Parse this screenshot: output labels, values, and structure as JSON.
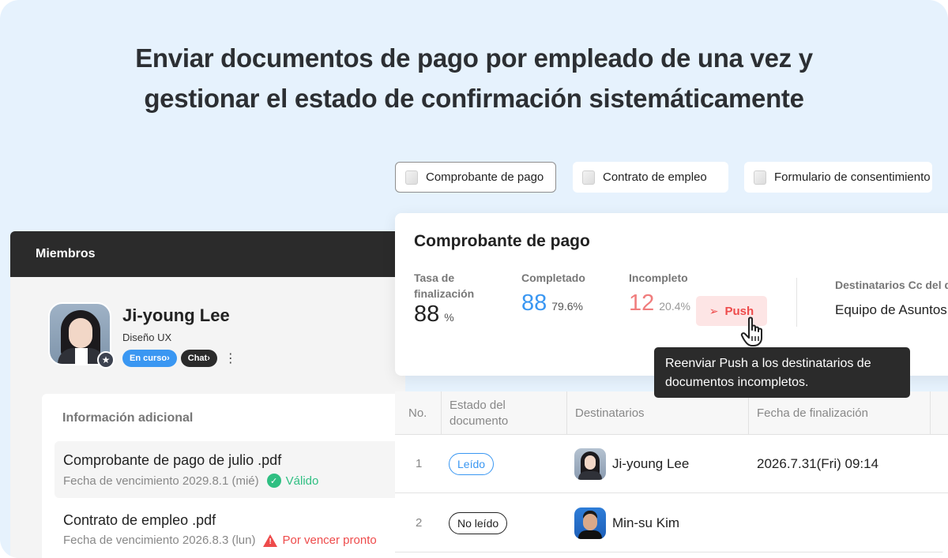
{
  "headline": {
    "line1": "Enviar documentos de pago por empleado de una vez y",
    "line2": "gestionar el estado de confirmación sistemáticamente"
  },
  "doc_tabs": [
    {
      "label": "Comprobante de pago",
      "active": true
    },
    {
      "label": "Contrato de empleo",
      "active": false
    },
    {
      "label": "Formulario de consentimiento",
      "active": false
    }
  ],
  "members": {
    "header": "Miembros",
    "profile": {
      "name": "Ji-young Lee",
      "role": "Diseño UX",
      "status_pill": "En curso",
      "chat_pill": "Chat"
    },
    "info": {
      "title": "Información adicional",
      "documents": [
        {
          "name": "Comprobante de pago de julio .pdf",
          "due": "Fecha de vencimiento 2029.8.1 (mié)",
          "status": "Válido",
          "status_type": "ok"
        },
        {
          "name": "Contrato de empleo .pdf",
          "due": "Fecha de vencimiento 2026.8.3 (lun)",
          "status": "Por vencer pronto",
          "status_type": "warn"
        }
      ]
    }
  },
  "summary": {
    "title": "Comprobante de pago",
    "completion_rate": {
      "label": "Tasa de finalización",
      "value": "88",
      "unit": "%"
    },
    "completed": {
      "label": "Completado",
      "value": "88",
      "percent": "79.6%"
    },
    "incomplete": {
      "label": "Incompleto",
      "value": "12",
      "percent": "20.4%"
    },
    "push_label": "Push",
    "cc": {
      "label": "Destinatarios Cc del documento",
      "value": "Equipo de Asuntos Generales"
    }
  },
  "tooltip": "Reenviar Push a los destinatarios de documentos incompletos.",
  "table": {
    "headers": [
      "No.",
      "Estado del documento",
      "Destinatarios",
      "Fecha de finalización"
    ],
    "rows": [
      {
        "no": "1",
        "status": "Leído",
        "status_type": "read",
        "recipient": "Ji-young Lee",
        "date": "2026.7.31(Fri) 09:14"
      },
      {
        "no": "2",
        "status": "No leído",
        "status_type": "unread",
        "recipient": "Min-su Kim",
        "date": ""
      }
    ]
  },
  "colors": {
    "background": "#e6f2fd",
    "accent_blue": "#3a97f2",
    "alert_red": "#ee4b4b",
    "ok_green": "#2fbf82",
    "dark": "#2b2b2b"
  },
  "icons": {
    "doc_tab": "document-icon",
    "star": "star-icon",
    "chevron": "chevron-right-icon",
    "more": "kebab-menu-icon",
    "valid": "check-circle-icon",
    "warning": "warning-triangle-icon",
    "push": "paper-plane-icon",
    "cursor": "hand-pointer-icon"
  }
}
